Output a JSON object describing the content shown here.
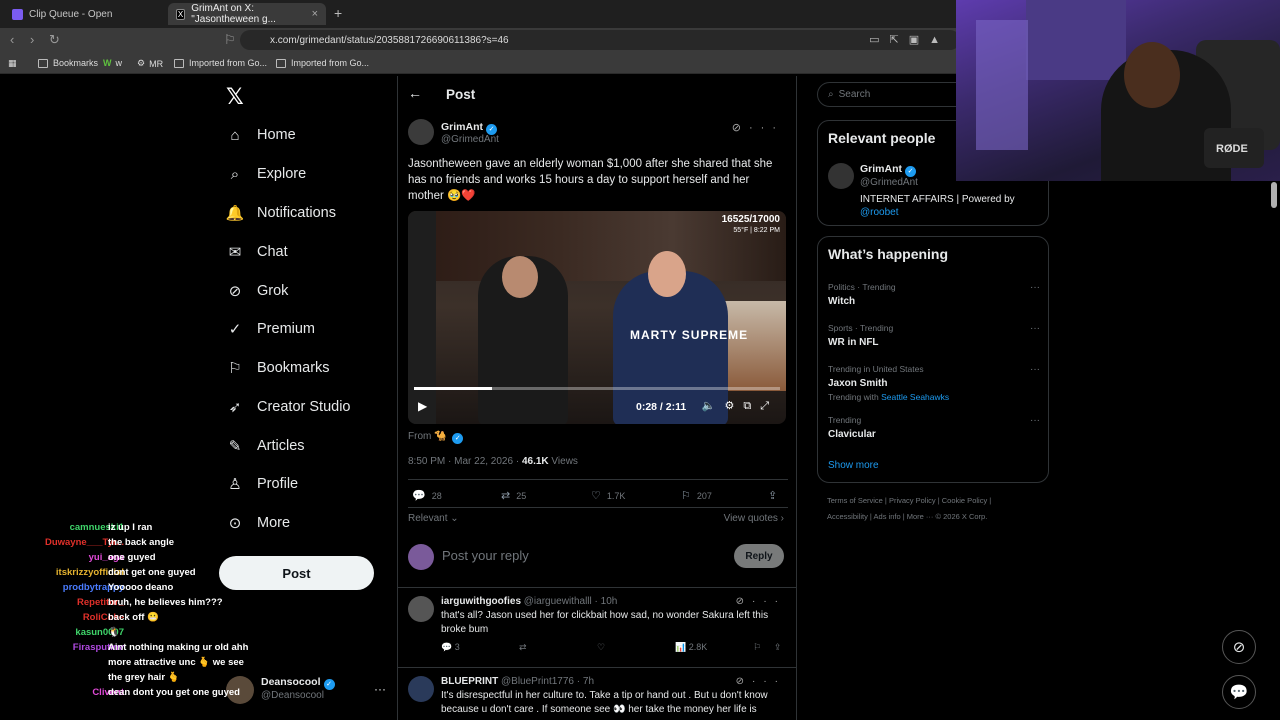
{
  "browser": {
    "tabs": [
      {
        "label": "Clip Queue - Open"
      },
      {
        "label": "GrimAnt on X: \"Jasontheween g...",
        "close": "×"
      }
    ],
    "new_tab": "+",
    "url": "x.com/grimedant/status/2035881726690611386?s=46",
    "bookmarks": [
      "Bookmarks",
      "w",
      "MR",
      "Imported from Go...",
      "Imported from Go..."
    ]
  },
  "nav": {
    "logo": "𝕏",
    "items": [
      {
        "label": "Home",
        "icon": "home-icon",
        "glyph": "⌂"
      },
      {
        "label": "Explore",
        "icon": "search-icon",
        "glyph": "⌕"
      },
      {
        "label": "Notifications",
        "icon": "bell-icon",
        "glyph": "🔔"
      },
      {
        "label": "Chat",
        "icon": "envelope-icon",
        "glyph": "✉"
      },
      {
        "label": "Grok",
        "icon": "grok-icon",
        "glyph": "⊘"
      },
      {
        "label": "Premium",
        "icon": "premium-icon",
        "glyph": "✓"
      },
      {
        "label": "Bookmarks",
        "icon": "bookmark-icon",
        "glyph": "⚐"
      },
      {
        "label": "Creator Studio",
        "icon": "rocket-icon",
        "glyph": "➶"
      },
      {
        "label": "Articles",
        "icon": "articles-icon",
        "glyph": "✎"
      },
      {
        "label": "Profile",
        "icon": "person-icon",
        "glyph": "♙"
      },
      {
        "label": "More",
        "icon": "more-circle-icon",
        "glyph": "⊙"
      }
    ],
    "post_button": "Post",
    "account": {
      "name": "Deansocool",
      "handle": "@Deansocool",
      "more": "···"
    }
  },
  "chat": [
    {
      "user": "camnueski1",
      "msg": "iz up I ran",
      "color": "#3fd46a"
    },
    {
      "user": "Duwayne___Tyr...",
      "msg": "the back angle",
      "color": "#e0302a"
    },
    {
      "user": "yui_aga",
      "msg": "one guyed",
      "color": "#e14ad8"
    },
    {
      "user": "itskrizzyofficial",
      "msg": "dont get one guyed",
      "color": "#e5b330"
    },
    {
      "user": "prodbytrappy",
      "msg": "Yooooo deano",
      "color": "#4a7cff"
    },
    {
      "user": "Repetitor_",
      "msg": "bruh, he believes him???",
      "color": "#e0302a"
    },
    {
      "user": "RoliCoke",
      "msg": "back off 😬",
      "color": "#e0302a"
    },
    {
      "user": "kasun0007",
      "msg": "🐧",
      "color": "#3fd46a"
    },
    {
      "user": "Firasputinv",
      "msg": "Aint nothing making ur old ahh",
      "color": "#b04ae0"
    },
    {
      "user": "",
      "msg": "more attractive unc 🫰 we see",
      "color": "#ffffff"
    },
    {
      "user": "",
      "msg": "the grey hair 🫰",
      "color": "#ffffff"
    },
    {
      "user": "Clivent",
      "msg": "dean dont you get one guyed",
      "color": "#e14ad8"
    }
  ],
  "post": {
    "header": "Post",
    "author": "GrimAnt",
    "handle": "@GrimedAnt",
    "text": "Jasontheween gave an elderly woman $1,000 after she shared that she has no friends and works 15 hours a day to support herself and her mother 🥹❤️",
    "video": {
      "counter": "16525/17000",
      "weather": "55°F | 8:22 PM",
      "shirt_text": "MARTY SUPREME",
      "time": "0:28 / 2:11",
      "progress": 0.213
    },
    "from_label": "From",
    "timestamp": "8:50 PM · Mar 22, 2026 ·",
    "views_count": "46.1K",
    "views_label": "Views",
    "stats": {
      "replies": "28",
      "reposts": "25",
      "likes": "1.7K",
      "bookmarks": "207"
    },
    "relevant": "Relevant ⌄",
    "view_quotes": "View quotes ›",
    "reply_placeholder": "Post your reply",
    "reply_button": "Reply"
  },
  "replies": [
    {
      "name": "iarguwithgoofies",
      "handle": "@iarguewithalll · 10h",
      "text": "that's all? Jason used her for clickbait how sad, no wonder Sakura left this broke bum",
      "replies": "3",
      "views": "2.8K"
    },
    {
      "name": "BLUEPRINT",
      "handle": "@BluePrint1776 · 7h",
      "text": "It's disrespectful in her culture  to. Take a tip or hand out . But u don't know because u don't care . If someone see 👀  her take the money  her life is"
    }
  ],
  "sidebar": {
    "search_placeholder": "Search",
    "relevant_title": "Relevant people",
    "person": {
      "name": "GrimAnt",
      "handle": "@GrimedAnt",
      "bio": "INTERNET AFFAIRS | Powered by",
      "bio_link": "@roobet"
    },
    "happening_title": "What’s happening",
    "trends": [
      {
        "context": "Politics · Trending",
        "name": "Witch",
        "with": "",
        "with_link": ""
      },
      {
        "context": "Sports · Trending",
        "name": "WR in NFL",
        "with": "",
        "with_link": ""
      },
      {
        "context": "Trending in United States",
        "name": "Jaxon Smith",
        "with": "Trending with",
        "with_link": "Seattle Seahawks"
      },
      {
        "context": "Trending",
        "name": "Clavicular",
        "with": "",
        "with_link": ""
      }
    ],
    "show_more": "Show more",
    "footer_line1": "Terms of Service  |  Privacy Policy  |  Cookie Policy  |",
    "footer_line2": "Accessibility  |  Ads info  |  More ···  © 2026 X Corp."
  },
  "cam": {
    "mic_label": "RØDE"
  },
  "colors": {
    "accent": "#1d9bf0",
    "bg": "#000000",
    "border": "#2f3336"
  }
}
